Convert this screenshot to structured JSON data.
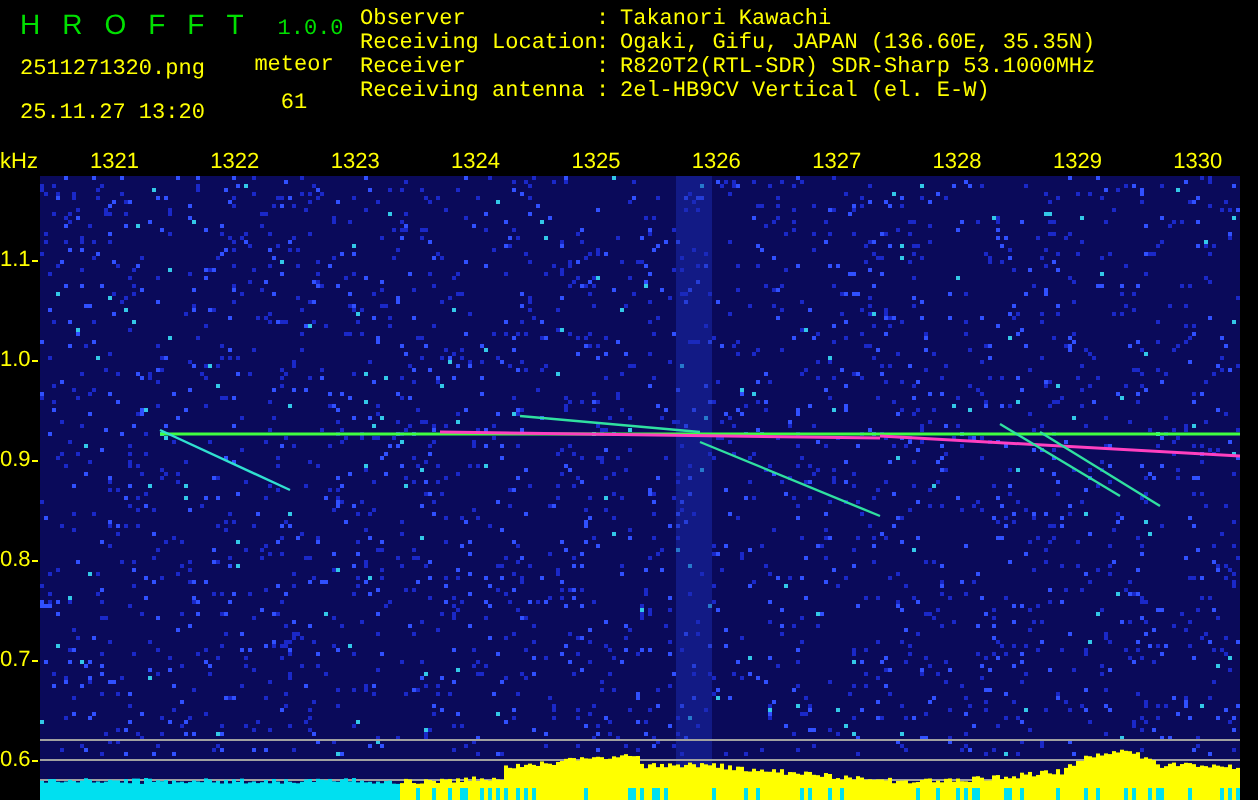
{
  "app": {
    "name": "HROFFT",
    "version": "1.0.0"
  },
  "file": {
    "filename": "2511271320.png",
    "datetime": "25.11.27 13:20"
  },
  "counter": {
    "label": "meteor",
    "value": "61"
  },
  "station_info": [
    {
      "label": "Observer",
      "separator": ":",
      "value": "Takanori Kawachi"
    },
    {
      "label": "Receiving Location",
      "separator": ":",
      "value": "Ogaki, Gifu, JAPAN (136.60E, 35.35N)"
    },
    {
      "label": "Receiver",
      "separator": ":",
      "value": "R820T2(RTL-SDR) SDR-Sharp 53.1000MHz"
    },
    {
      "label": "Receiving antenna",
      "separator": ":",
      "value": "2el-HB9CV Vertical (el. E-W)"
    }
  ],
  "spectrogram": {
    "y_unit": "kHz",
    "x_ticks": [
      "1321",
      "1322",
      "1323",
      "1324",
      "1325",
      "1326",
      "1327",
      "1328",
      "1329",
      "1330"
    ],
    "y_ticks": [
      "1.1",
      "1.0",
      "0.9",
      "0.8",
      "0.7",
      "0.6"
    ]
  }
}
